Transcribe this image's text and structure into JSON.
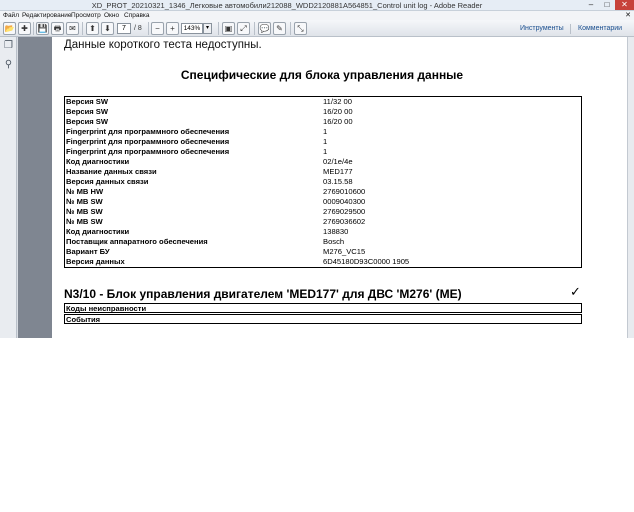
{
  "window": {
    "title": "XD_PROT_20210321_1346_Легковые автомобили212088_WDD2120881A564851_Control unit log - Adobe Reader",
    "minimize": "–",
    "maximize": "□",
    "close": "✕"
  },
  "menu": {
    "items": [
      "Файл",
      "Редактирование",
      "Просмотр",
      "Окно",
      "Справка"
    ],
    "close_doc": "✕"
  },
  "toolbar": {
    "page_current": "7",
    "page_total": "/ 8",
    "zoom": "143%",
    "tools_label": "Инструменты",
    "comments_label": "Комментарии"
  },
  "document": {
    "short_test_note": "Данные короткого теста недоступны.",
    "specific_title": "Специфические для блока управления данные",
    "rows": [
      {
        "k": "Версия SW",
        "v": "11/32 00"
      },
      {
        "k": "Версия SW",
        "v": "16/20 00"
      },
      {
        "k": "Версия SW",
        "v": "16/20 00"
      },
      {
        "k": "Fingerprint для программного обеспечения",
        "v": "1"
      },
      {
        "k": "Fingerprint для программного обеспечения",
        "v": "1"
      },
      {
        "k": "Fingerprint для программного обеспечения",
        "v": "1"
      },
      {
        "k": "Код диагностики",
        "v": "02/1e/4e"
      },
      {
        "k": "Название данных связи",
        "v": "MED177"
      },
      {
        "k": "Версия данных связи",
        "v": "03.15.58"
      },
      {
        "k": "№ MB HW",
        "v": "2769010600"
      },
      {
        "k": "№ MB SW",
        "v": "0009040300"
      },
      {
        "k": "№ MB SW",
        "v": "2769029500"
      },
      {
        "k": "№ MB SW",
        "v": "2769036602"
      },
      {
        "k": "Код диагностики",
        "v": "138830"
      },
      {
        "k": "Поставщик аппаратного обеспечения",
        "v": "Bosch"
      },
      {
        "k": "Вариант БУ",
        "v": "M276_VC15"
      },
      {
        "k": "Версия данных",
        "v": "6D45180D93C0000 1905"
      }
    ],
    "section_title": "N3/10 - Блок управления двигателем 'MED177' для ДВС 'M276' (ME)",
    "section_check": "✓",
    "fault_codes_label": "Коды неисправности",
    "events_label": "События"
  },
  "icons": {
    "open": "📂",
    "create": "✚",
    "save": "💾",
    "print": "🖶",
    "mail": "✉",
    "prev": "⬆",
    "next": "⬇",
    "zoom_out": "−",
    "zoom_in": "+",
    "fit_page": "▣",
    "fit_width": "⤢",
    "comment": "💬",
    "highlight": "✎",
    "expand": "⤡",
    "panel_pages": "❐",
    "panel_attach": "⚲"
  }
}
